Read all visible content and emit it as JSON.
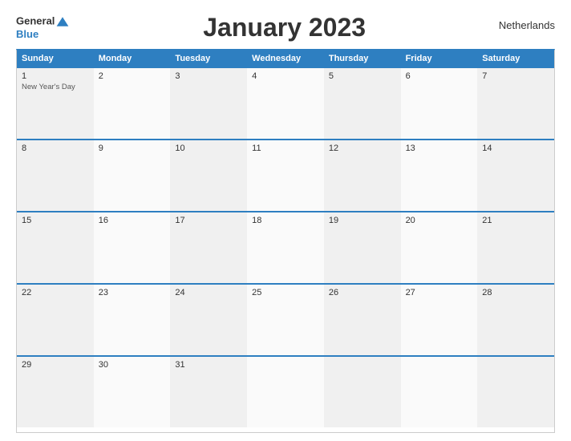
{
  "header": {
    "logo_line1": "General",
    "logo_line2": "Blue",
    "title": "January 2023",
    "country": "Netherlands"
  },
  "calendar": {
    "days_of_week": [
      "Sunday",
      "Monday",
      "Tuesday",
      "Wednesday",
      "Thursday",
      "Friday",
      "Saturday"
    ],
    "weeks": [
      [
        {
          "day": "1",
          "holiday": "New Year's Day"
        },
        {
          "day": "2",
          "holiday": ""
        },
        {
          "day": "3",
          "holiday": ""
        },
        {
          "day": "4",
          "holiday": ""
        },
        {
          "day": "5",
          "holiday": ""
        },
        {
          "day": "6",
          "holiday": ""
        },
        {
          "day": "7",
          "holiday": ""
        }
      ],
      [
        {
          "day": "8",
          "holiday": ""
        },
        {
          "day": "9",
          "holiday": ""
        },
        {
          "day": "10",
          "holiday": ""
        },
        {
          "day": "11",
          "holiday": ""
        },
        {
          "day": "12",
          "holiday": ""
        },
        {
          "day": "13",
          "holiday": ""
        },
        {
          "day": "14",
          "holiday": ""
        }
      ],
      [
        {
          "day": "15",
          "holiday": ""
        },
        {
          "day": "16",
          "holiday": ""
        },
        {
          "day": "17",
          "holiday": ""
        },
        {
          "day": "18",
          "holiday": ""
        },
        {
          "day": "19",
          "holiday": ""
        },
        {
          "day": "20",
          "holiday": ""
        },
        {
          "day": "21",
          "holiday": ""
        }
      ],
      [
        {
          "day": "22",
          "holiday": ""
        },
        {
          "day": "23",
          "holiday": ""
        },
        {
          "day": "24",
          "holiday": ""
        },
        {
          "day": "25",
          "holiday": ""
        },
        {
          "day": "26",
          "holiday": ""
        },
        {
          "day": "27",
          "holiday": ""
        },
        {
          "day": "28",
          "holiday": ""
        }
      ],
      [
        {
          "day": "29",
          "holiday": ""
        },
        {
          "day": "30",
          "holiday": ""
        },
        {
          "day": "31",
          "holiday": ""
        },
        {
          "day": "",
          "holiday": ""
        },
        {
          "day": "",
          "holiday": ""
        },
        {
          "day": "",
          "holiday": ""
        },
        {
          "day": "",
          "holiday": ""
        }
      ]
    ]
  }
}
